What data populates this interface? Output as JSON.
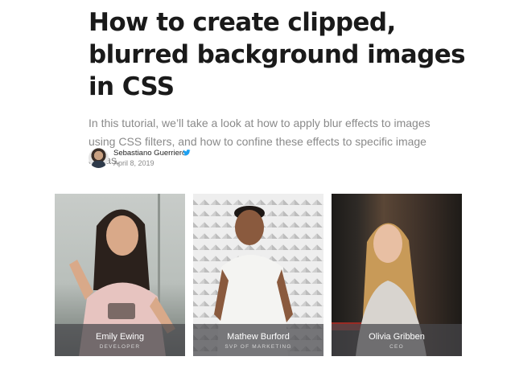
{
  "article": {
    "title_lines": [
      "How to create clipped,",
      "blurred background images",
      "in CSS"
    ],
    "lede": "In this tutorial, we’ll take a look at how to apply blur effects to images using CSS filters, and how to confine these effects to specific image areas."
  },
  "author": {
    "name": "Sebastiano Guerriero",
    "date": "April 8, 2019",
    "social_icon": "twitter-bird-icon",
    "social_color": "#1da1f2"
  },
  "cards": [
    {
      "name": "Emily Ewing",
      "role": "DEVELOPER"
    },
    {
      "name": "Mathew Burford",
      "role": "SVP OF MARKETING"
    },
    {
      "name": "Olivia Gribben",
      "role": "CEO"
    }
  ]
}
